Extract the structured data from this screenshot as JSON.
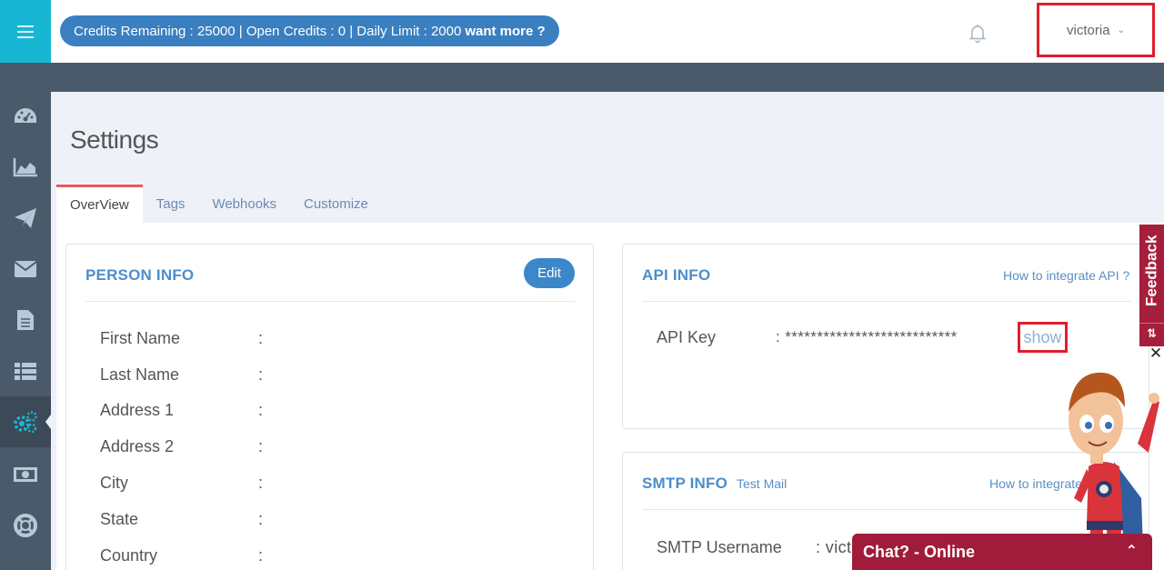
{
  "topbar": {
    "credits_text": "Credits Remaining : 25000 | Open Credits : 0 | Daily Limit : 2000",
    "want_more": "want more ?",
    "username": "victoria"
  },
  "sidebar": {
    "items": [
      {
        "icon": "dashboard-icon"
      },
      {
        "icon": "area-chart-icon"
      },
      {
        "icon": "paper-plane-icon"
      },
      {
        "icon": "envelope-icon"
      },
      {
        "icon": "document-icon"
      },
      {
        "icon": "list-icon"
      },
      {
        "icon": "settings-gears-icon",
        "active": true
      },
      {
        "icon": "money-icon"
      },
      {
        "icon": "lifebuoy-icon"
      }
    ]
  },
  "page": {
    "title": "Settings",
    "tabs": [
      {
        "label": "OverView",
        "active": true
      },
      {
        "label": "Tags"
      },
      {
        "label": "Webhooks"
      },
      {
        "label": "Customize"
      }
    ]
  },
  "person_info": {
    "title": "PERSON INFO",
    "edit_label": "Edit",
    "fields": [
      {
        "label": "First Name",
        "sep": ":"
      },
      {
        "label": "Last Name",
        "sep": ":"
      },
      {
        "label": "Address 1",
        "sep": ":"
      },
      {
        "label": "Address 2",
        "sep": ":"
      },
      {
        "label": "City",
        "sep": ":"
      },
      {
        "label": "State",
        "sep": ":"
      },
      {
        "label": "Country",
        "sep": ":"
      }
    ]
  },
  "api_info": {
    "title": "API INFO",
    "help_link": "How to integrate API ?",
    "key_label": "API Key",
    "key_value": ": ***************************",
    "show_label": "show"
  },
  "smtp_info": {
    "title": "SMTP INFO",
    "test_mail": "Test Mail",
    "help_link": "How to integrate",
    "username_label": "SMTP Username",
    "username_value": ": victo"
  },
  "widgets": {
    "feedback_label": "Feedback",
    "feedback_icon": "⇅",
    "close": "✕",
    "chat_label": "Chat? - Online",
    "chat_caret": "⌃"
  },
  "colors": {
    "accent_teal": "#17b7d3",
    "pill_blue": "#3a7fbf",
    "sidebar": "#4a5a6a",
    "highlight_red": "#e01d2c",
    "chat_red": "#a01c3a"
  }
}
